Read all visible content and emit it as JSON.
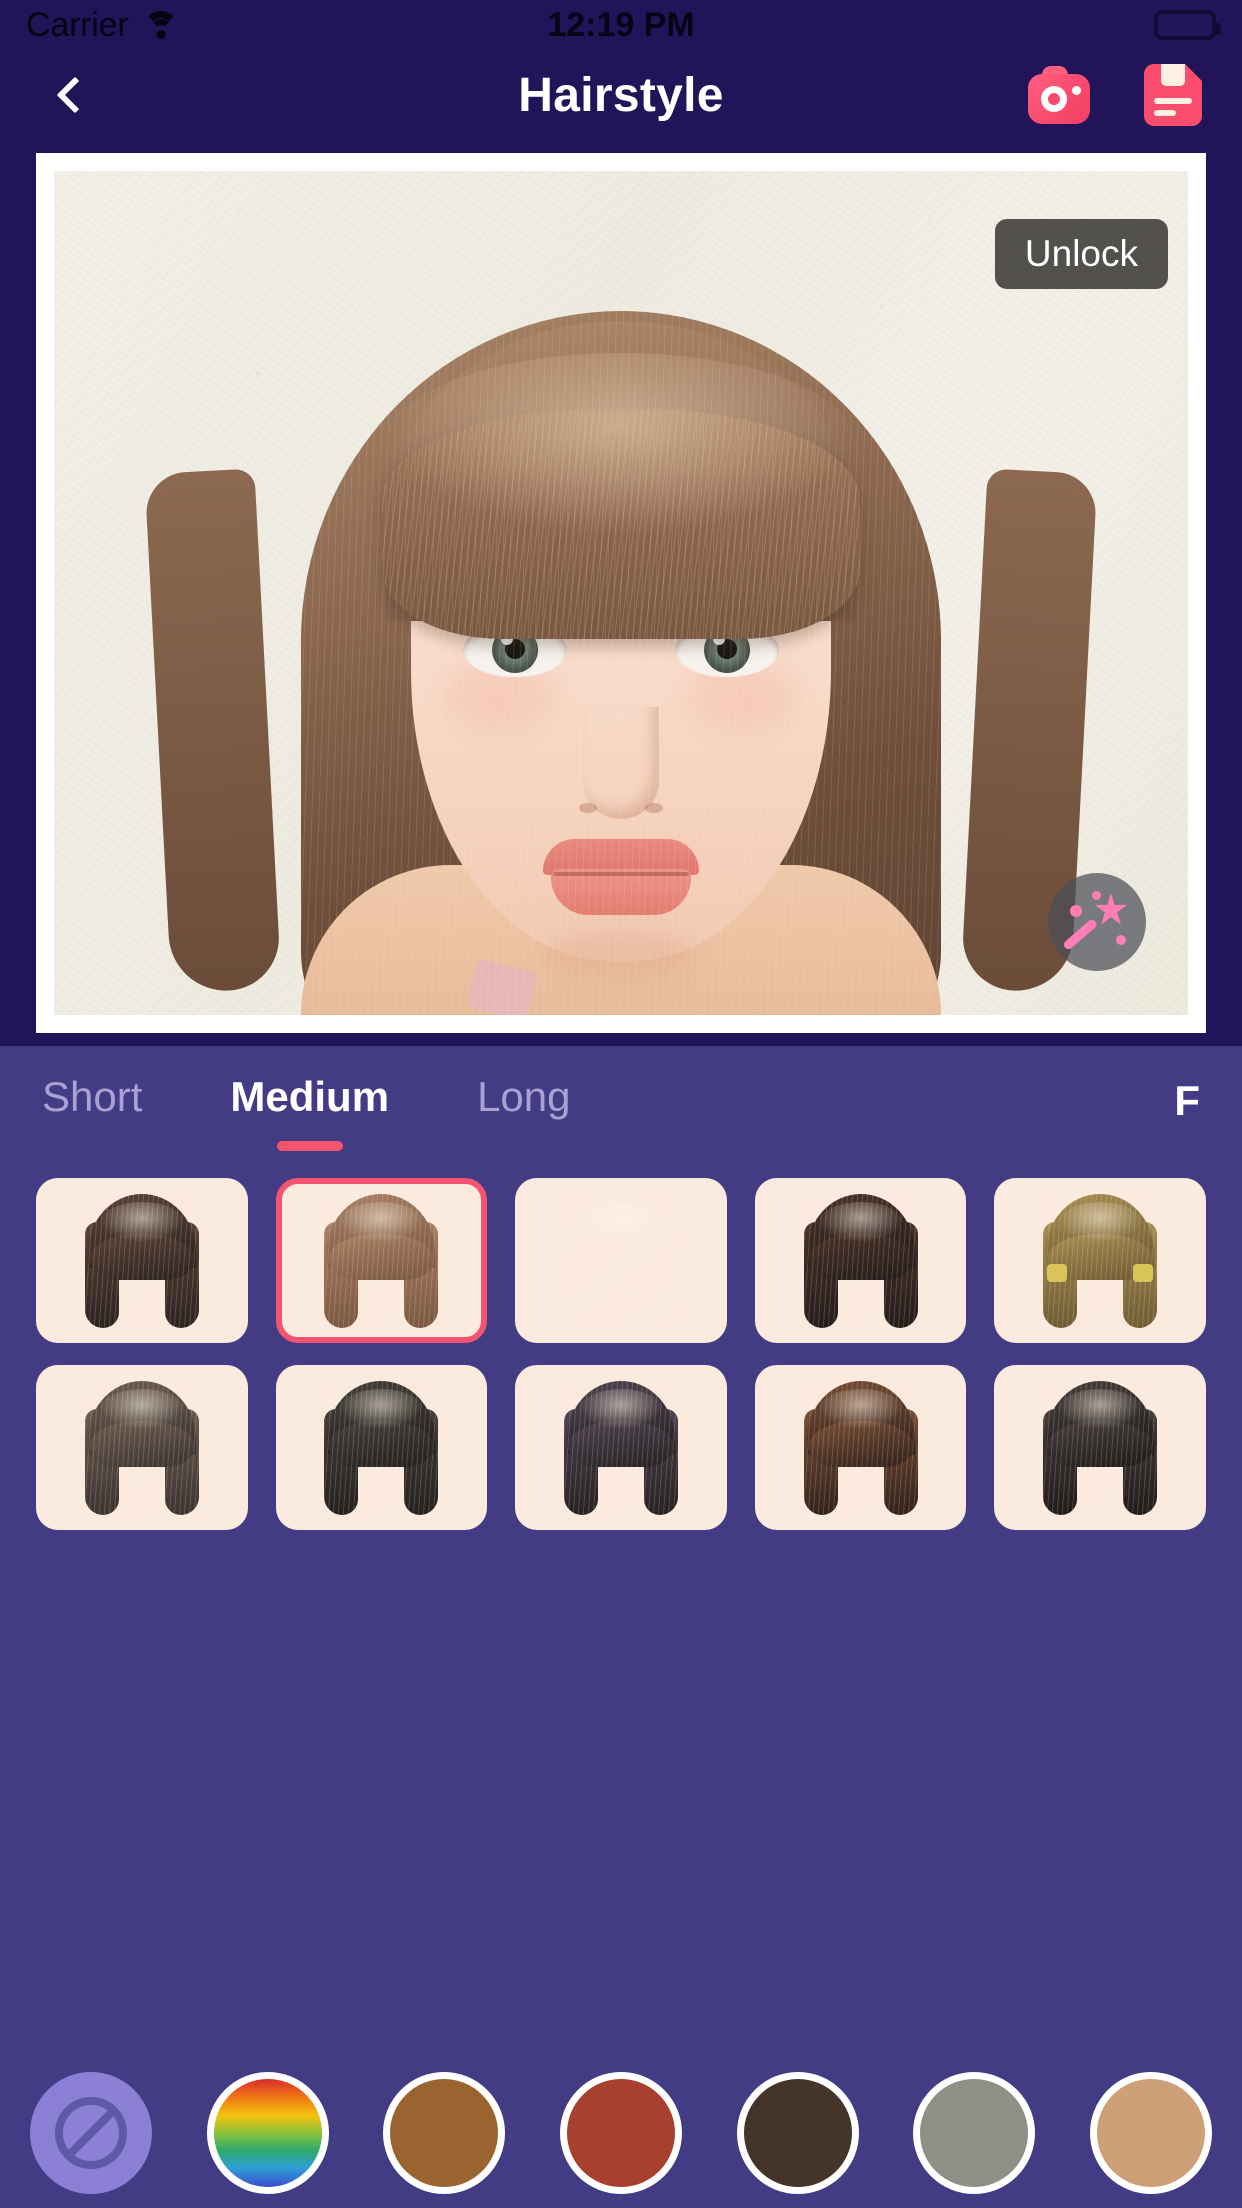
{
  "status_bar": {
    "carrier": "Carrier",
    "wifi_icon": "wifi-icon",
    "time": "12:19 PM",
    "battery_icon": "battery-full-icon"
  },
  "nav_bar": {
    "back_icon": "chevron-left-icon",
    "title": "Hairstyle",
    "camera_icon": "camera-icon",
    "save_icon": "save-document-icon"
  },
  "photo": {
    "unlock_label": "Unlock",
    "magic_icon": "magic-wand-icon"
  },
  "tabs": {
    "items": [
      {
        "label": "Short",
        "active": false
      },
      {
        "label": "Medium",
        "active": true
      },
      {
        "label": "Long",
        "active": false
      }
    ],
    "more_label": "F",
    "active_indicator_color": "#f4546f"
  },
  "styles": {
    "selected_index": 1,
    "items": [
      {
        "name": "style-1",
        "hair_dark": "#2c231f",
        "hair_light": "#5a4238",
        "shape": "straight-bob",
        "clips": false
      },
      {
        "name": "style-2",
        "hair_dark": "#7a5740",
        "hair_light": "#a98164",
        "shape": "bangs-bob",
        "clips": false
      },
      {
        "name": "style-3",
        "hair_dark": "#7b6murky",
        "hair_light": "#b99f76",
        "shape": "layered-bob",
        "clips": false
      },
      {
        "name": "style-4",
        "hair_dark": "#241c1a",
        "hair_light": "#4a332a",
        "shape": "sleek-bob",
        "clips": false
      },
      {
        "name": "style-5",
        "hair_dark": "#6e5a33",
        "hair_light": "#a88e52",
        "shape": "bangs-clips",
        "clips": true
      },
      {
        "name": "style-6",
        "hair_dark": "#3b332f",
        "hair_light": "#6d5d52",
        "shape": "side-part-bob",
        "clips": false
      },
      {
        "name": "style-7",
        "hair_dark": "#23201e",
        "hair_light": "#45403a",
        "shape": "long-curtain",
        "clips": false
      },
      {
        "name": "style-8",
        "hair_dark": "#262022",
        "hair_light": "#4e4450",
        "shape": "earring-bob",
        "clips": false
      },
      {
        "name": "style-9",
        "hair_dark": "#30211b",
        "hair_light": "#7a4f36",
        "shape": "round-bangs",
        "clips": false
      },
      {
        "name": "style-10",
        "hair_dark": "#1f1b1a",
        "hair_light": "#473f3c",
        "shape": "wavy-bob",
        "clips": false
      }
    ]
  },
  "colors": {
    "items": [
      {
        "name": "none",
        "type": "none",
        "hex": "#8b7fd6"
      },
      {
        "name": "rainbow",
        "type": "gradient",
        "hex": "#d92b2b"
      },
      {
        "name": "caramel-brown",
        "type": "solid",
        "hex": "#9a6430"
      },
      {
        "name": "brick-red",
        "type": "solid",
        "hex": "#a8402f"
      },
      {
        "name": "dark-brown",
        "type": "solid",
        "hex": "#44342a"
      },
      {
        "name": "sage-gray",
        "type": "solid",
        "hex": "#8d9185"
      },
      {
        "name": "tan",
        "type": "solid",
        "hex": "#cda077"
      }
    ]
  },
  "theme": {
    "nav_background": "#221459",
    "panel_background": "#433c84",
    "accent_pink": "#f4546f",
    "thumb_background": "#fbeade"
  }
}
